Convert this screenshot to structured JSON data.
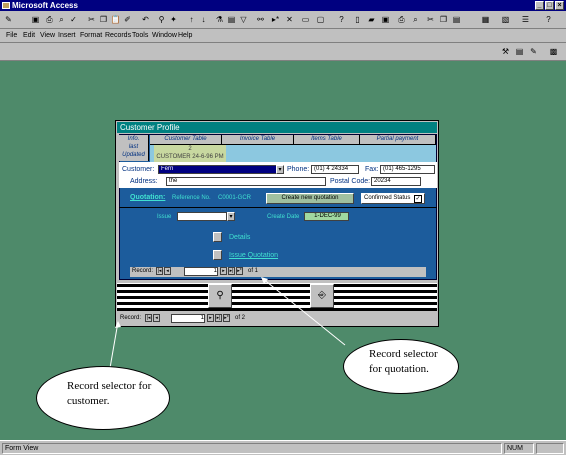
{
  "window": {
    "title": "Microsoft Access",
    "min": "_",
    "max": "□",
    "close": "×"
  },
  "menu": [
    "File",
    "Edit",
    "View",
    "Insert",
    "Format",
    "Records",
    "Tools",
    "Window",
    "Help"
  ],
  "form": {
    "title": "Customer Profile",
    "header_left": [
      "Info.",
      "last",
      "Updated"
    ],
    "tabs": [
      "Customer Table",
      "Invoice Table",
      "Items Table",
      "Partial payment"
    ],
    "header_values": [
      "2",
      "CUSTOMER 24-6-96 PM"
    ],
    "customer_label": "Customer:",
    "customer_value": "Fern",
    "phone_label": "Phone:",
    "phone_value": "(01) 4 24334",
    "fax_label": "Fax:",
    "fax_value": "(01) 465-1295",
    "address_label": "Address:",
    "address_value": "the",
    "postal_label": "Postal Code:",
    "postal_value": "20234",
    "quotation_label": "Quotation:",
    "reference_label": "Reference No.",
    "reference_value": "C0001-GCR",
    "create_button": "Create new quotation",
    "confirmed_label": "Confirmed Status",
    "issue_label": "Issue",
    "date_label": "Create Date",
    "date_value": "1-DEC-99",
    "details_label": "Details",
    "issue_quotation_label": "Issue Quotation",
    "sub_record_label": "Record:",
    "sub_record_value": "1",
    "sub_record_of": "of 1",
    "main_record_label": "Record:",
    "main_record_value": "1",
    "main_record_of": "of 2"
  },
  "status": {
    "left": "Form View",
    "right": "NUM"
  },
  "callouts": {
    "customer": [
      "Record selector for",
      "customer."
    ],
    "quotation": [
      "Record selector",
      "for quotation."
    ]
  }
}
